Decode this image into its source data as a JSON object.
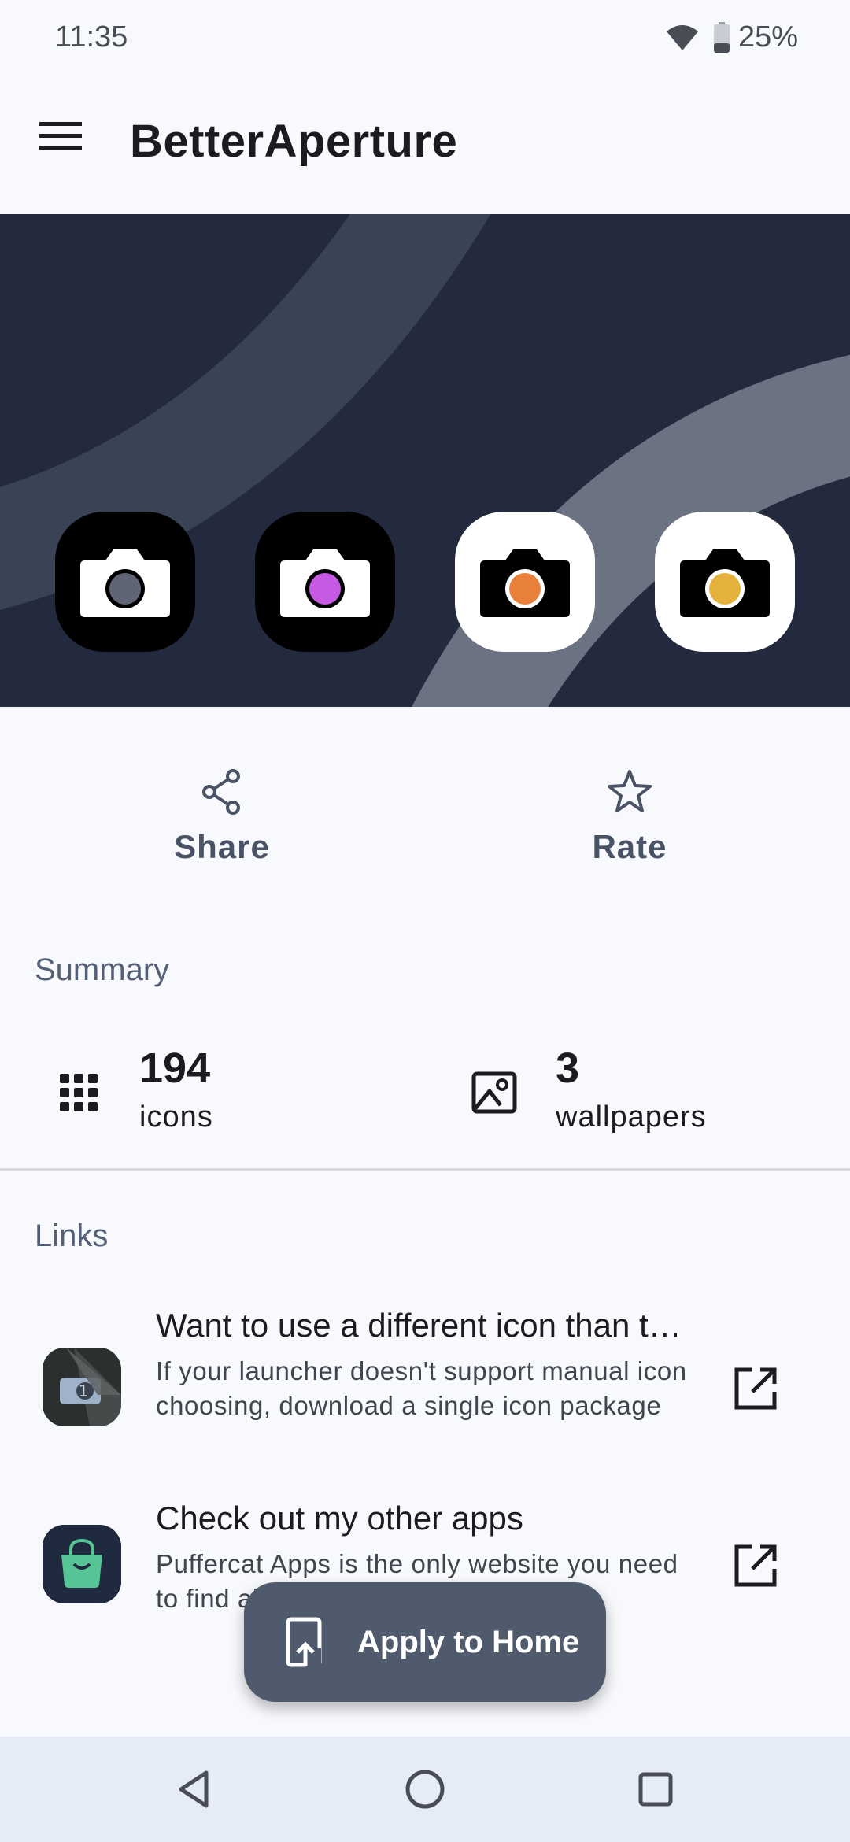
{
  "status_bar": {
    "time": "11:35",
    "battery_percent": "25%",
    "icons": [
      "wifi-icon",
      "battery-icon"
    ]
  },
  "app_bar": {
    "title": "BetterAperture",
    "menu_icon": "menu-icon"
  },
  "hero": {
    "preview_icons": [
      {
        "name": "camera-icon-gray",
        "lens_color": "#5f6575",
        "style": "dark"
      },
      {
        "name": "camera-icon-purple",
        "lens_color": "#c75ae3",
        "style": "dark"
      },
      {
        "name": "camera-icon-orange",
        "lens_color": "#e8803a",
        "style": "light"
      },
      {
        "name": "camera-icon-yellow",
        "lens_color": "#e3b23c",
        "style": "light"
      }
    ],
    "background_color": "#232a3d"
  },
  "actions": {
    "share_label": "Share",
    "rate_label": "Rate"
  },
  "summary": {
    "heading": "Summary",
    "icons_count": "194",
    "icons_unit": "icons",
    "wallpapers_count": "3",
    "wallpapers_unit": "wallpapers"
  },
  "links": {
    "heading": "Links",
    "items": [
      {
        "title": "Want to use a different icon than the default?",
        "description": "If your launcher doesn't support manual icon choosing, download a single icon package",
        "icon": "single-icon-package-icon"
      },
      {
        "title": "Check out my other apps",
        "description": "Puffercat Apps is the only website you need to find all of my other great apps",
        "icon": "store-bag-icon"
      }
    ]
  },
  "fab": {
    "label": "Apply to Home"
  },
  "nav_bar": {
    "buttons": [
      "back-icon",
      "home-icon",
      "recents-icon"
    ]
  }
}
